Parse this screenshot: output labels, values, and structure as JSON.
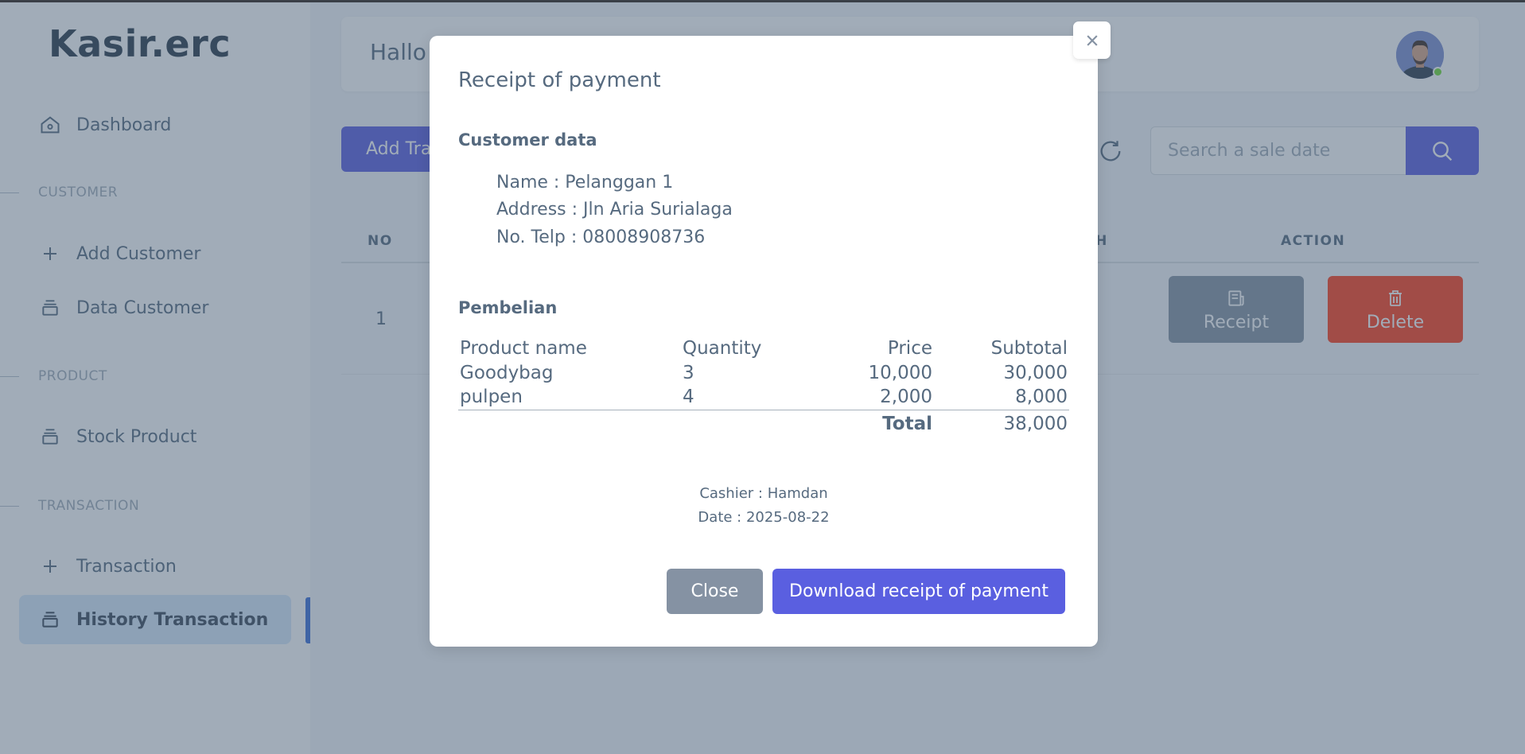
{
  "app": {
    "brand": "Kasir.erc"
  },
  "sidebar": {
    "dashboard": "Dashboard",
    "sections": [
      {
        "header": "CUSTOMER",
        "items": [
          "Add Customer",
          "Data Customer"
        ]
      },
      {
        "header": "PRODUCT",
        "items": [
          "Stock Product"
        ]
      },
      {
        "header": "TRANSACTION",
        "items": [
          "Transaction",
          "History Transaction"
        ]
      }
    ]
  },
  "topbar": {
    "greeting": "Hallo"
  },
  "toolbar": {
    "add_label": "Add Tra",
    "search_placeholder": "Search a sale date"
  },
  "table": {
    "headers": {
      "no": "NO",
      "partial": "TH",
      "action": "ACTION"
    },
    "rows": [
      {
        "no": "1"
      }
    ],
    "receipt_label": "Receipt",
    "delete_label": "Delete"
  },
  "modal": {
    "title": "Receipt of payment",
    "customer_section": "Customer data",
    "customer": {
      "name": "Name : Pelanggan 1",
      "address": "Address : Jln Aria Surialaga",
      "phone": "No. Telp : 08008908736"
    },
    "purchase_section": "Pembelian",
    "columns": {
      "product": "Product name",
      "quantity": "Quantity",
      "price": "Price",
      "subtotal": "Subtotal"
    },
    "items": [
      {
        "product": "Goodybag",
        "quantity": "3",
        "price": "10,000",
        "subtotal": "30,000"
      },
      {
        "product": "pulpen",
        "quantity": "4",
        "price": "2,000",
        "subtotal": "8,000"
      }
    ],
    "total_label": "Total",
    "total_value": "38,000",
    "cashier": "Cashier : Hamdan",
    "date": "Date : 2025-08-22",
    "close_label": "Close",
    "download_label": "Download receipt of payment"
  },
  "colors": {
    "primary": "#5a5fe0",
    "secondary": "#8592a3",
    "danger": "#ff3e1d",
    "active_bg": "#d7e8fb",
    "online": "#71dd37"
  },
  "icons": {
    "dashboard": "home-icon",
    "add": "plus-icon",
    "data": "layers-icon",
    "refresh": "refresh-icon",
    "search": "search-icon",
    "receipt": "receipt-icon",
    "delete": "trash-icon",
    "close": "close-icon"
  }
}
